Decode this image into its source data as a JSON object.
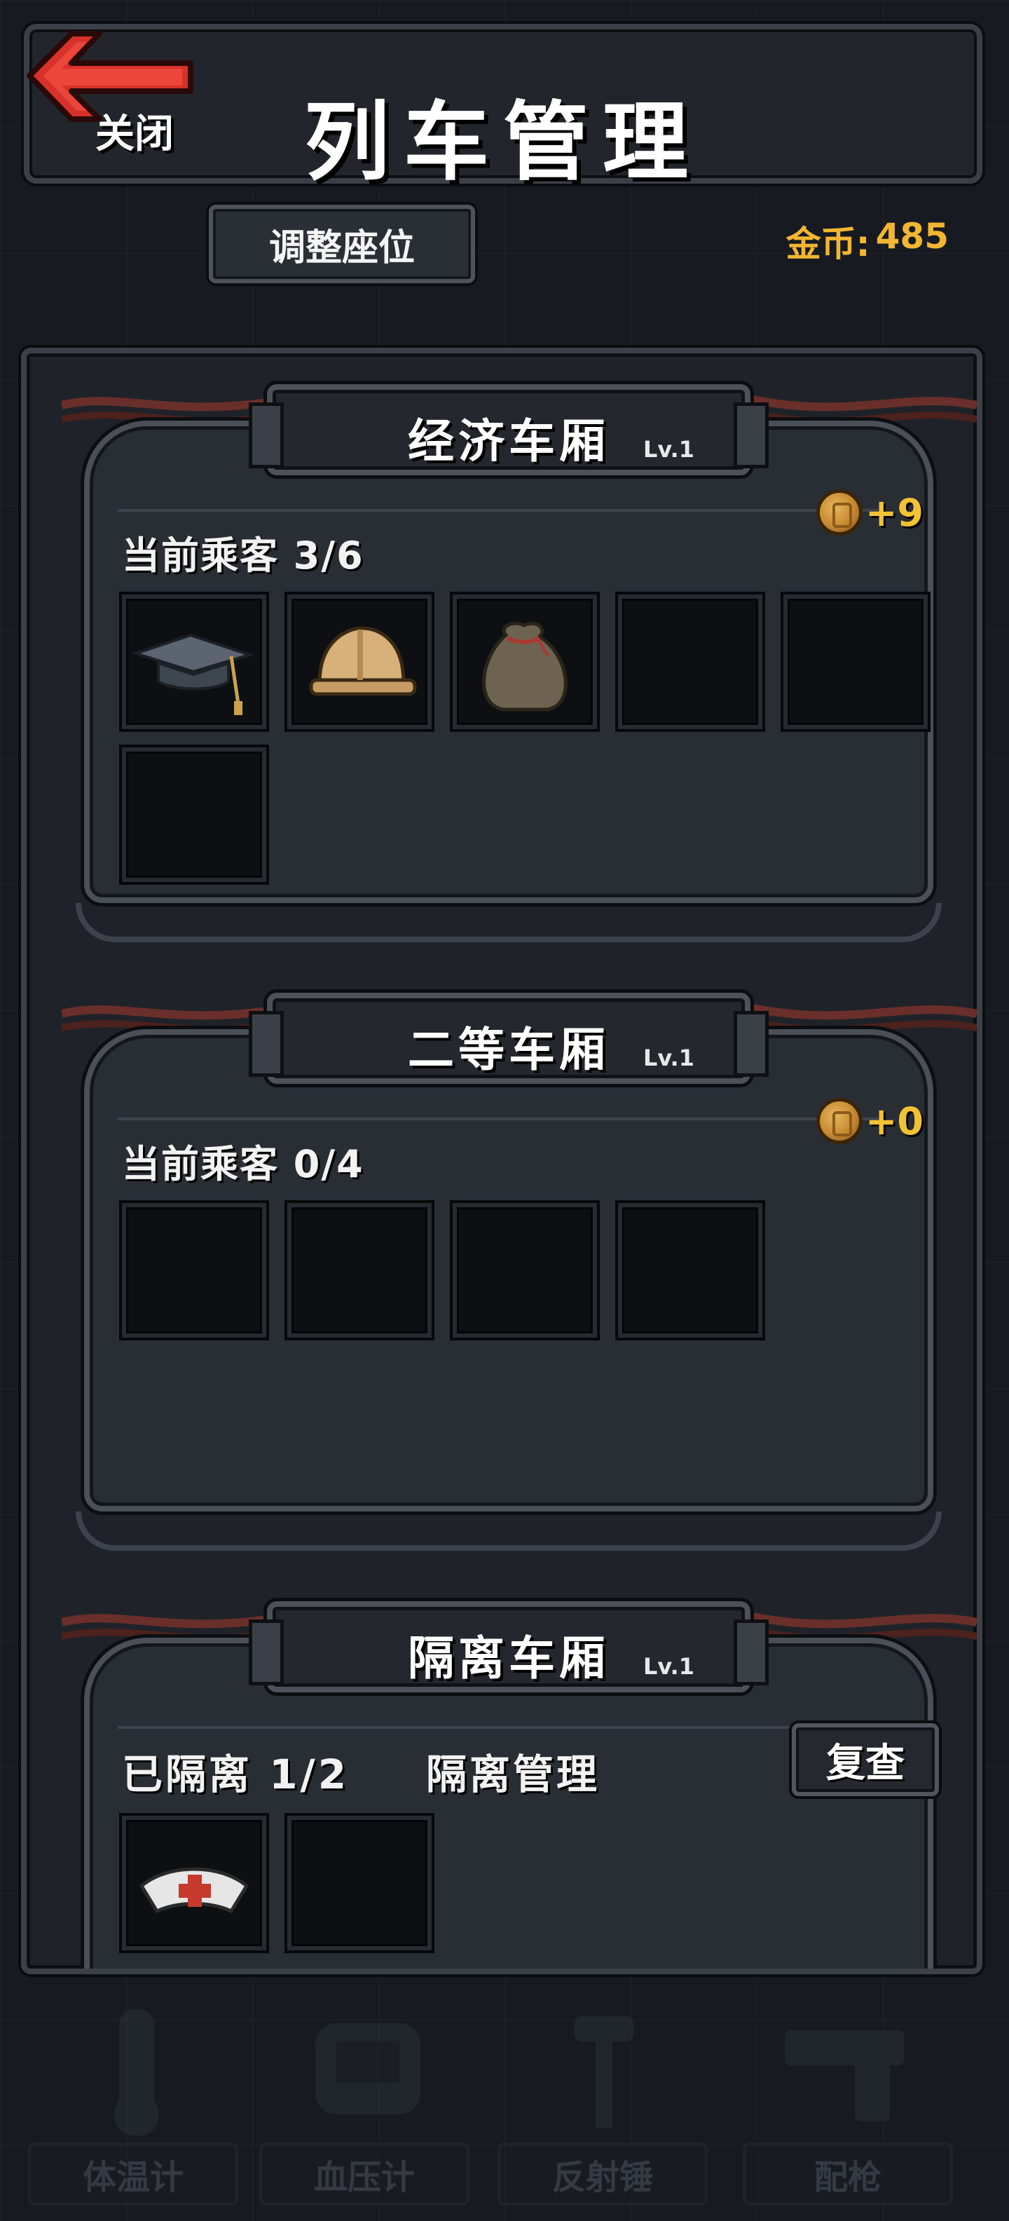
{
  "header": {
    "back_label": "关闭",
    "title": "列车管理"
  },
  "toolbar": {
    "adjust_seats_label": "调整座位",
    "coins_label": "金币:",
    "coins_value": "485"
  },
  "cars": [
    {
      "name": "经济车厢",
      "level": "Lv.1",
      "income": "+9",
      "passengers_label": "当前乘客 3/6",
      "slots": [
        "graduation-cap",
        "hard-hat",
        "sack",
        "empty",
        "empty",
        "empty"
      ]
    },
    {
      "name": "二等车厢",
      "level": "Lv.1",
      "income": "+0",
      "passengers_label": "当前乘客 0/4",
      "slots": [
        "empty",
        "empty",
        "empty",
        "empty"
      ]
    },
    {
      "name": "隔离车厢",
      "level": "Lv.1",
      "isolated_label": "已隔离 1/2",
      "manage_label": "隔离管理",
      "recheck_label": "复查",
      "slots": [
        "nurse-cap",
        "empty"
      ]
    }
  ],
  "bottom_tools": [
    "体温计",
    "血压计",
    "反射锤",
    "配枪"
  ],
  "colors": {
    "coin_text": "#f2b632",
    "back_arrow": "#e0302a",
    "panel_border": "#4a4f58"
  }
}
